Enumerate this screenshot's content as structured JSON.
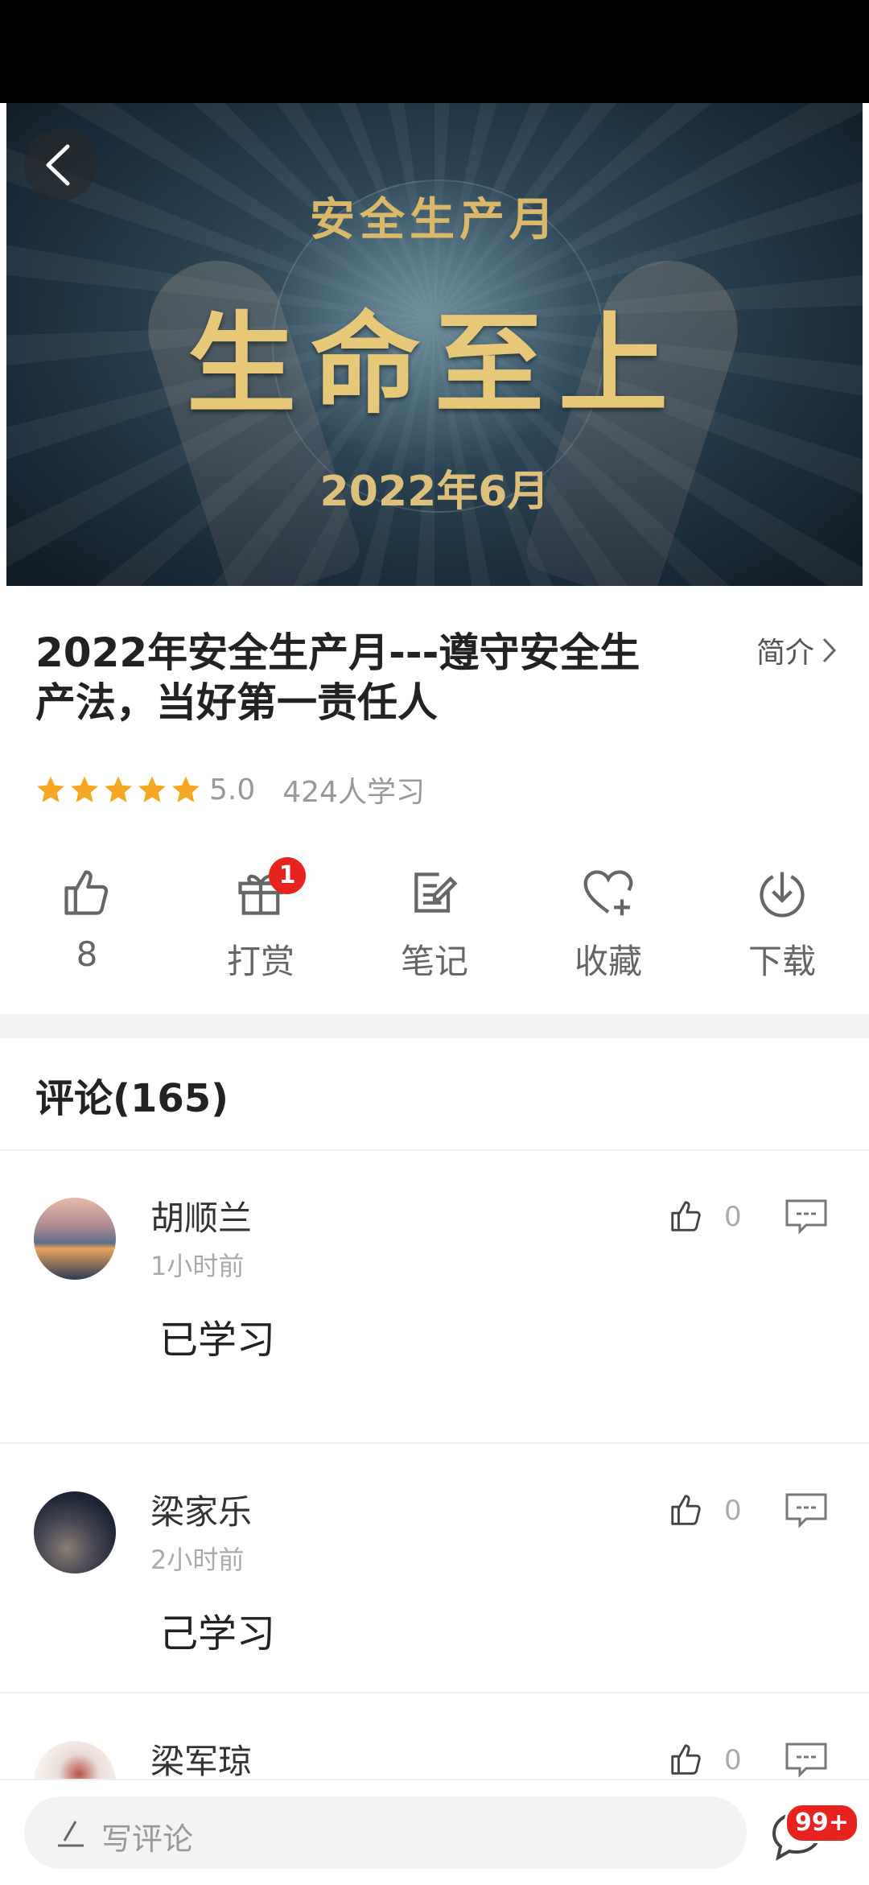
{
  "video": {
    "subtitle": "安全生产月",
    "title": "生命至上",
    "date": "2022年6月"
  },
  "course": {
    "title": "2022年安全生产月---遵守安全生产法，当好第一责任人",
    "intro_label": "简介",
    "rating": "5.0",
    "stars": 5,
    "learners": "424人学习"
  },
  "actions": [
    {
      "icon": "thumbs-up-icon",
      "label": "8"
    },
    {
      "icon": "gift-icon",
      "label": "打赏",
      "badge": "1"
    },
    {
      "icon": "note-icon",
      "label": "笔记"
    },
    {
      "icon": "heart-plus-icon",
      "label": "收藏"
    },
    {
      "icon": "download-icon",
      "label": "下载"
    }
  ],
  "comments_header": "评论(165)",
  "comments": [
    {
      "name": "胡顺兰",
      "time": "1小时前",
      "text": "已学习",
      "likes": "0"
    },
    {
      "name": "梁家乐",
      "time": "2小时前",
      "text": "己学习",
      "likes": "0"
    },
    {
      "name": "梁军琼",
      "time": "",
      "text": "",
      "likes": "0"
    }
  ],
  "bottom_bar": {
    "placeholder": "写评论",
    "message_badge": "99+"
  },
  "colors": {
    "accent": "#e8231f",
    "star": "#f5a623"
  }
}
